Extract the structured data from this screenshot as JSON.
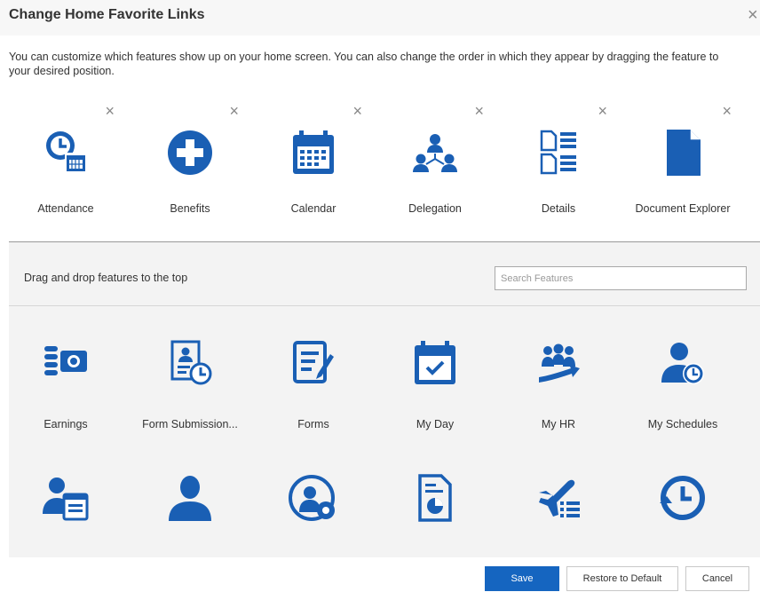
{
  "dialog": {
    "title": "Change Home Favorite Links",
    "close_glyph": "×",
    "description": "You can customize which features show up on your home screen. You can also change the order in which they appear by dragging the feature to your desired position."
  },
  "colors": {
    "accent": "#1565c0",
    "icon_blue": "#1a5fb4",
    "panel_bg": "#f3f3f3"
  },
  "favorites": [
    {
      "label": "Attendance",
      "icon": "attendance-icon",
      "remove": "×"
    },
    {
      "label": "Benefits",
      "icon": "benefits-icon",
      "remove": "×"
    },
    {
      "label": "Calendar",
      "icon": "calendar-icon",
      "remove": "×"
    },
    {
      "label": "Delegation",
      "icon": "delegation-icon",
      "remove": "×"
    },
    {
      "label": "Details",
      "icon": "details-icon",
      "remove": "×"
    },
    {
      "label": "Document Explorer",
      "icon": "document-icon",
      "remove": "×"
    }
  ],
  "available": {
    "instruction": "Drag and drop features to the top",
    "search_placeholder": "Search Features",
    "features": [
      {
        "label": "Earnings",
        "icon": "earnings-icon"
      },
      {
        "label": "Form Submission...",
        "icon": "form-submission-icon"
      },
      {
        "label": "Forms",
        "icon": "forms-icon"
      },
      {
        "label": "My Day",
        "icon": "my-day-icon"
      },
      {
        "label": "My HR",
        "icon": "my-hr-icon"
      },
      {
        "label": "My Schedules",
        "icon": "my-schedules-icon"
      },
      {
        "label": "",
        "icon": "person-calendar-icon"
      },
      {
        "label": "",
        "icon": "person-icon"
      },
      {
        "label": "",
        "icon": "person-settings-icon"
      },
      {
        "label": "",
        "icon": "report-document-icon"
      },
      {
        "label": "",
        "icon": "travel-icon"
      },
      {
        "label": "",
        "icon": "time-history-icon"
      }
    ]
  },
  "footer": {
    "save": "Save",
    "restore": "Restore to Default",
    "cancel": "Cancel"
  }
}
